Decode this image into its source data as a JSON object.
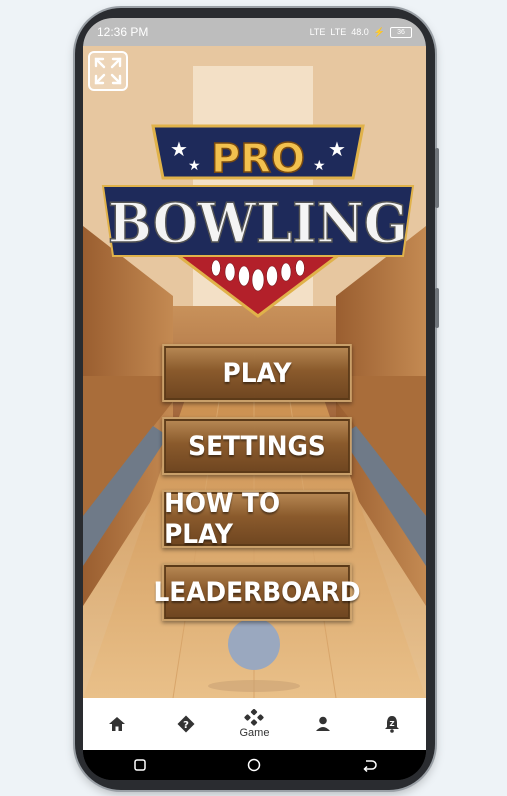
{
  "status_bar": {
    "time": "12:36 PM",
    "signal1": "LTE",
    "signal2": "LTE",
    "speed": "48.0",
    "battery": "36"
  },
  "game": {
    "logo": {
      "line1": "PRO",
      "line2": "BOWLING"
    },
    "menu": [
      {
        "label": "PLAY"
      },
      {
        "label": "SETTINGS"
      },
      {
        "label": "HOW TO PLAY"
      },
      {
        "label": "LEADERBOARD"
      }
    ]
  },
  "bottom_nav": {
    "items": [
      {
        "icon": "home-icon",
        "label": ""
      },
      {
        "icon": "help-icon",
        "label": ""
      },
      {
        "icon": "gamepad-icon",
        "label": "Game"
      },
      {
        "icon": "profile-icon",
        "label": ""
      },
      {
        "icon": "notification-icon",
        "label": ""
      }
    ]
  }
}
